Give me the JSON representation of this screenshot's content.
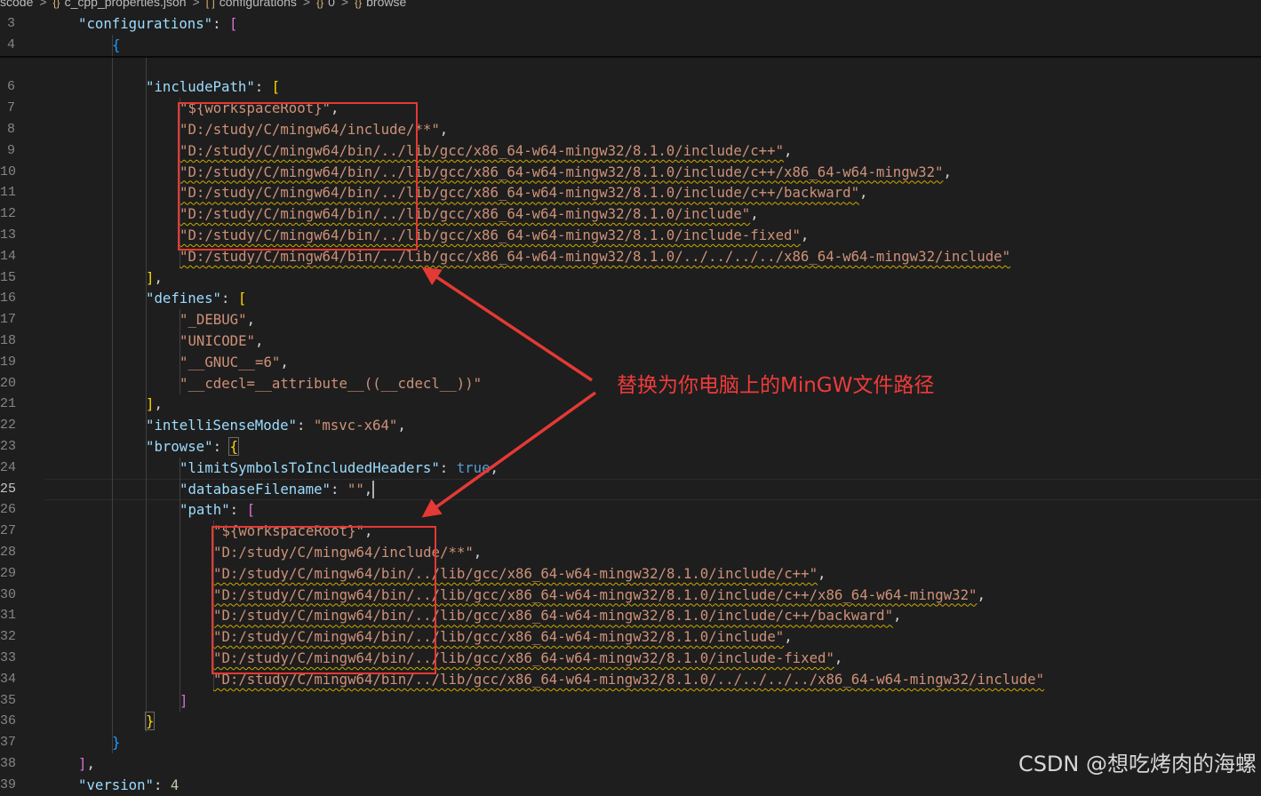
{
  "breadcrumb": {
    "items": [
      "scode",
      "c_cpp_properties.json",
      "configurations",
      "0",
      "browse"
    ],
    "icons": [
      "",
      "{}",
      "[ ]",
      "{}",
      "{}"
    ]
  },
  "active_line": 25,
  "lines": [
    {
      "n": "3",
      "indent": 2,
      "parts": [
        {
          "t": "\"configurations\"",
          "c": "k"
        },
        {
          "t": ": ",
          "c": "p"
        },
        {
          "t": "[",
          "c": "b1"
        }
      ]
    },
    {
      "n": "4",
      "indent": 3,
      "parts": [
        {
          "t": "{",
          "c": "b2"
        }
      ]
    },
    {
      "n": "",
      "indent": 4,
      "parts": []
    },
    {
      "n": "6",
      "indent": 4,
      "parts": [
        {
          "t": "\"includePath\"",
          "c": "k"
        },
        {
          "t": ": ",
          "c": "p"
        },
        {
          "t": "[",
          "c": "b3"
        }
      ]
    },
    {
      "n": "7",
      "indent": 5,
      "parts": [
        {
          "t": "\"${workspaceRoot}\"",
          "c": "s"
        },
        {
          "t": ",",
          "c": "p"
        }
      ]
    },
    {
      "n": "8",
      "indent": 5,
      "parts": [
        {
          "t": "\"D:/study/C/mingw64/include/**\"",
          "c": "s"
        },
        {
          "t": ",",
          "c": "p"
        }
      ]
    },
    {
      "n": "9",
      "indent": 5,
      "parts": [
        {
          "t": "\"D:/study/C/mingw64/bin/../lib/gcc/x86_64-w64-mingw32/8.1.0/include/c++\"",
          "c": "s sq"
        },
        {
          "t": ",",
          "c": "p"
        }
      ]
    },
    {
      "n": "10",
      "indent": 5,
      "parts": [
        {
          "t": "\"D:/study/C/mingw64/bin/../lib/gcc/x86_64-w64-mingw32/8.1.0/include/c++/x86_64-w64-mingw32\"",
          "c": "s sq"
        },
        {
          "t": ",",
          "c": "p"
        }
      ]
    },
    {
      "n": "11",
      "indent": 5,
      "parts": [
        {
          "t": "\"D:/study/C/mingw64/bin/../lib/gcc/x86_64-w64-mingw32/8.1.0/include/c++/backward\"",
          "c": "s sq"
        },
        {
          "t": ",",
          "c": "p"
        }
      ]
    },
    {
      "n": "12",
      "indent": 5,
      "parts": [
        {
          "t": "\"D:/study/C/mingw64/bin/../lib/gcc/x86_64-w64-mingw32/8.1.0/include\"",
          "c": "s sq"
        },
        {
          "t": ",",
          "c": "p"
        }
      ]
    },
    {
      "n": "13",
      "indent": 5,
      "parts": [
        {
          "t": "\"D:/study/C/mingw64/bin/../lib/gcc/x86_64-w64-mingw32/8.1.0/include-fixed\"",
          "c": "s sq"
        },
        {
          "t": ",",
          "c": "p"
        }
      ]
    },
    {
      "n": "14",
      "indent": 5,
      "parts": [
        {
          "t": "\"D:/study/C/mingw64/bin/../lib/gcc/x86_64-w64-mingw32/8.1.0/../../../../x86_64-w64-mingw32/include\"",
          "c": "s sq"
        }
      ]
    },
    {
      "n": "15",
      "indent": 4,
      "parts": [
        {
          "t": "]",
          "c": "b3"
        },
        {
          "t": ",",
          "c": "p"
        }
      ]
    },
    {
      "n": "16",
      "indent": 4,
      "parts": [
        {
          "t": "\"defines\"",
          "c": "k"
        },
        {
          "t": ": ",
          "c": "p"
        },
        {
          "t": "[",
          "c": "b3"
        }
      ]
    },
    {
      "n": "17",
      "indent": 5,
      "parts": [
        {
          "t": "\"_DEBUG\"",
          "c": "s"
        },
        {
          "t": ",",
          "c": "p"
        }
      ]
    },
    {
      "n": "18",
      "indent": 5,
      "parts": [
        {
          "t": "\"UNICODE\"",
          "c": "s"
        },
        {
          "t": ",",
          "c": "p"
        }
      ]
    },
    {
      "n": "19",
      "indent": 5,
      "parts": [
        {
          "t": "\"__GNUC__=6\"",
          "c": "s"
        },
        {
          "t": ",",
          "c": "p"
        }
      ]
    },
    {
      "n": "20",
      "indent": 5,
      "parts": [
        {
          "t": "\"__cdecl=__attribute__((__cdecl__))\"",
          "c": "s"
        }
      ]
    },
    {
      "n": "21",
      "indent": 4,
      "parts": [
        {
          "t": "]",
          "c": "b3"
        },
        {
          "t": ",",
          "c": "p"
        }
      ]
    },
    {
      "n": "22",
      "indent": 4,
      "parts": [
        {
          "t": "\"intelliSenseMode\"",
          "c": "k"
        },
        {
          "t": ": ",
          "c": "p"
        },
        {
          "t": "\"msvc-x64\"",
          "c": "s"
        },
        {
          "t": ",",
          "c": "p"
        }
      ]
    },
    {
      "n": "23",
      "indent": 4,
      "parts": [
        {
          "t": "\"browse\"",
          "c": "k"
        },
        {
          "t": ": ",
          "c": "p"
        },
        {
          "t": "{",
          "c": "b3 hl-box"
        }
      ]
    },
    {
      "n": "24",
      "indent": 5,
      "parts": [
        {
          "t": "\"limitSymbolsToIncludedHeaders\"",
          "c": "k"
        },
        {
          "t": ": ",
          "c": "p"
        },
        {
          "t": "true",
          "c": "kw"
        },
        {
          "t": ",",
          "c": "p"
        }
      ]
    },
    {
      "n": "25",
      "indent": 5,
      "parts": [
        {
          "t": "\"databaseFilename\"",
          "c": "k"
        },
        {
          "t": ": ",
          "c": "p"
        },
        {
          "t": "\"\"",
          "c": "s"
        },
        {
          "t": ",",
          "c": "p"
        }
      ]
    },
    {
      "n": "26",
      "indent": 5,
      "parts": [
        {
          "t": "\"path\"",
          "c": "k"
        },
        {
          "t": ": ",
          "c": "p"
        },
        {
          "t": "[",
          "c": "b1"
        }
      ]
    },
    {
      "n": "27",
      "indent": 6,
      "parts": [
        {
          "t": "\"${workspaceRoot}\"",
          "c": "s"
        },
        {
          "t": ",",
          "c": "p"
        }
      ]
    },
    {
      "n": "28",
      "indent": 6,
      "parts": [
        {
          "t": "\"D:/study/C/mingw64/include/**\"",
          "c": "s"
        },
        {
          "t": ",",
          "c": "p"
        }
      ]
    },
    {
      "n": "29",
      "indent": 6,
      "parts": [
        {
          "t": "\"D:/study/C/mingw64/bin/../lib/gcc/x86_64-w64-mingw32/8.1.0/include/c++\"",
          "c": "s sq"
        },
        {
          "t": ",",
          "c": "p"
        }
      ]
    },
    {
      "n": "30",
      "indent": 6,
      "parts": [
        {
          "t": "\"D:/study/C/mingw64/bin/../lib/gcc/x86_64-w64-mingw32/8.1.0/include/c++/x86_64-w64-mingw32\"",
          "c": "s sq"
        },
        {
          "t": ",",
          "c": "p"
        }
      ]
    },
    {
      "n": "31",
      "indent": 6,
      "parts": [
        {
          "t": "\"D:/study/C/mingw64/bin/../lib/gcc/x86_64-w64-mingw32/8.1.0/include/c++/backward\"",
          "c": "s sq"
        },
        {
          "t": ",",
          "c": "p"
        }
      ]
    },
    {
      "n": "32",
      "indent": 6,
      "parts": [
        {
          "t": "\"D:/study/C/mingw64/bin/../lib/gcc/x86_64-w64-mingw32/8.1.0/include\"",
          "c": "s sq"
        },
        {
          "t": ",",
          "c": "p"
        }
      ]
    },
    {
      "n": "33",
      "indent": 6,
      "parts": [
        {
          "t": "\"D:/study/C/mingw64/bin/../lib/gcc/x86_64-w64-mingw32/8.1.0/include-fixed\"",
          "c": "s sq"
        },
        {
          "t": ",",
          "c": "p"
        }
      ]
    },
    {
      "n": "34",
      "indent": 6,
      "parts": [
        {
          "t": "\"D:/study/C/mingw64/bin/../lib/gcc/x86_64-w64-mingw32/8.1.0/../../../../x86_64-w64-mingw32/include\"",
          "c": "s sq"
        }
      ]
    },
    {
      "n": "35",
      "indent": 5,
      "parts": [
        {
          "t": "]",
          "c": "b1"
        }
      ]
    },
    {
      "n": "36",
      "indent": 4,
      "parts": [
        {
          "t": "}",
          "c": "b3 hl-box"
        }
      ]
    },
    {
      "n": "37",
      "indent": 3,
      "parts": [
        {
          "t": "}",
          "c": "b2"
        }
      ]
    },
    {
      "n": "38",
      "indent": 2,
      "parts": [
        {
          "t": "]",
          "c": "b1"
        },
        {
          "t": ",",
          "c": "p"
        }
      ]
    },
    {
      "n": "39",
      "indent": 2,
      "parts": [
        {
          "t": "\"version\"",
          "c": "k"
        },
        {
          "t": ": ",
          "c": "p"
        },
        {
          "t": "4",
          "c": "n"
        }
      ]
    }
  ],
  "annotation": {
    "text": "替换为你电脑上的MinGW文件路径",
    "color": "#ef3b3b"
  },
  "watermark": "CSDN @想吃烤肉的海螺",
  "colors": {
    "background": "#1e1e1e",
    "property": "#9cdcfe",
    "string": "#ce9178",
    "keyword": "#569cd6",
    "number": "#b5cea8",
    "annotation_red": "#e53935"
  }
}
